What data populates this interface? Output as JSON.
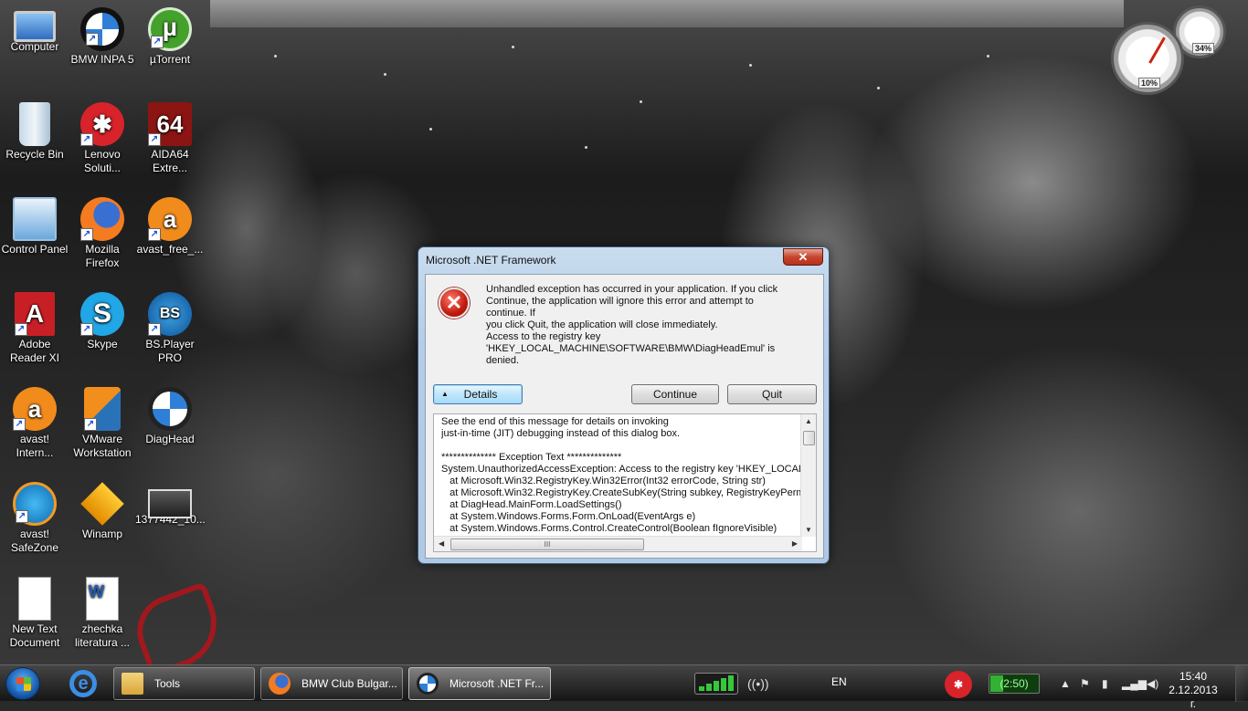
{
  "desktop": {
    "icons": [
      {
        "label": "Computer"
      },
      {
        "label": "BMW INPA 5"
      },
      {
        "label": "µTorrent"
      },
      {
        "label": "Recycle Bin"
      },
      {
        "label": "Lenovo Soluti..."
      },
      {
        "label": "AIDA64 Extre..."
      },
      {
        "label": "Control Panel"
      },
      {
        "label": "Mozilla Firefox"
      },
      {
        "label": "avast_free_..."
      },
      {
        "label": "Adobe Reader XI"
      },
      {
        "label": "Skype"
      },
      {
        "label": "BS.Player PRO"
      },
      {
        "label": "avast! Intern..."
      },
      {
        "label": "VMware Workstation"
      },
      {
        "label": "DiagHead"
      },
      {
        "label": "avast! SafeZone"
      },
      {
        "label": "Winamp"
      },
      {
        "label": "1377442_10..."
      },
      {
        "label": "New Text Document"
      },
      {
        "label": "zhechka literatura ..."
      }
    ]
  },
  "gadget": {
    "cpu": "10%",
    "memory": "34%"
  },
  "dialog": {
    "title": "Microsoft .NET Framework",
    "close": "✕",
    "message_lines": [
      "Unhandled exception has occurred in your application. If you click",
      "Continue, the application will ignore this error and attempt to continue. If",
      "you click Quit, the application will close immediately."
    ],
    "detail_lines": [
      "Access to the registry key",
      "'HKEY_LOCAL_MACHINE\\SOFTWARE\\BMW\\DiagHeadEmul' is",
      "denied."
    ],
    "buttons": {
      "details": "Details",
      "continue": "Continue",
      "quit": "Quit"
    },
    "details_text": "See the end of this message for details on invoking\njust-in-time (JIT) debugging instead of this dialog box.\n\n************** Exception Text **************\nSystem.UnauthorizedAccessException: Access to the registry key 'HKEY_LOCAL_M...\n   at Microsoft.Win32.RegistryKey.Win32Error(Int32 errorCode, String str)\n   at Microsoft.Win32.RegistryKey.CreateSubKey(String subkey, RegistryKeyPermissic\n   at DiagHead.MainForm.LoadSettings()\n   at System.Windows.Forms.Form.OnLoad(EventArgs e)\n   at System.Windows.Forms.Control.CreateControl(Boolean fIgnoreVisible)",
    "scroll_grip": "III"
  },
  "taskbar": {
    "tasks": [
      {
        "label": "Tools"
      },
      {
        "label": "BMW Club Bulgar..."
      },
      {
        "label": "Microsoft .NET Fr..."
      }
    ],
    "language": "EN",
    "battery": "(2:50)",
    "time": "15:40",
    "date": "2.12.2013 г."
  }
}
